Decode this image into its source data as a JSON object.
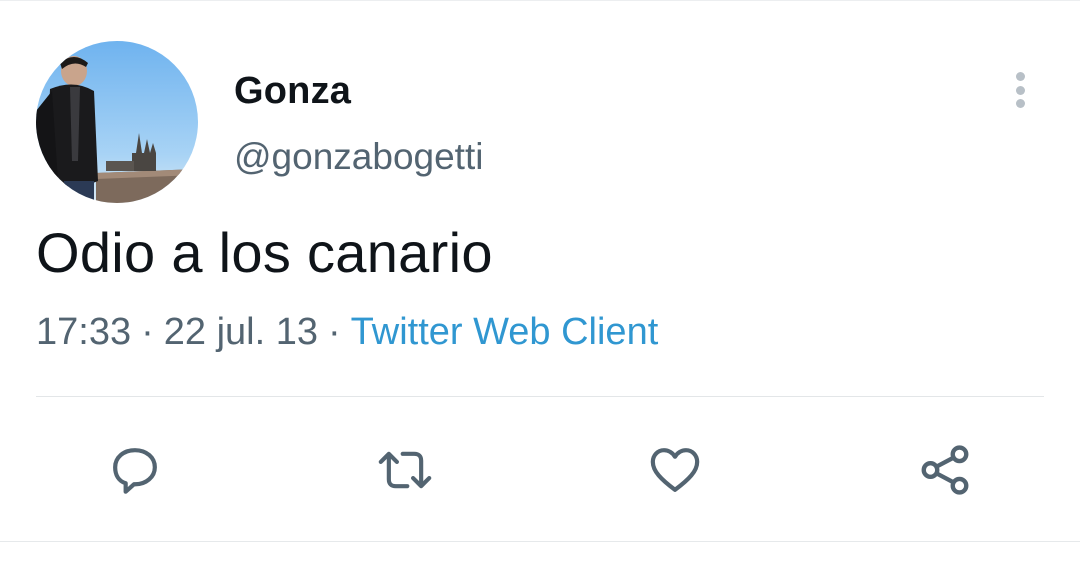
{
  "tweet": {
    "author_name": "Gonza",
    "author_handle": "@gonzabogetti",
    "text": "Odio a los canario",
    "time": "17:33",
    "separator": "·",
    "date": "22 jul. 13",
    "source": "Twitter Web Client"
  },
  "icons": {
    "more": "more-vertical-icon",
    "reply": "reply-icon",
    "retweet": "retweet-icon",
    "like": "heart-icon",
    "share": "share-icon"
  },
  "colors": {
    "text": "#0f1419",
    "secondary": "#536471",
    "link": "#3097d1",
    "icon": "#536471"
  }
}
